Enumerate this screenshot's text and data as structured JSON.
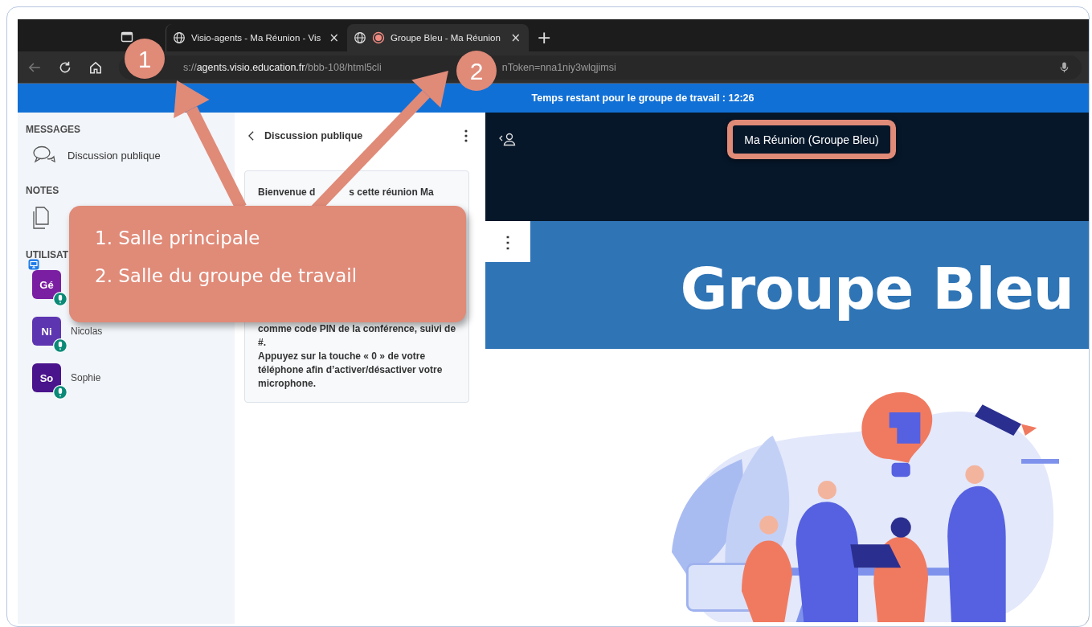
{
  "browser": {
    "tabs": [
      {
        "title": "Visio-agents - Ma Réunion - Vis",
        "close": "×",
        "selected": false,
        "recording": false
      },
      {
        "title": "Groupe Bleu - Ma Réunion",
        "close": "×",
        "selected": true,
        "recording": true
      }
    ],
    "new_tab": "+",
    "back_disabled": true,
    "address": [
      {
        "text": "s://",
        "kind": "dim"
      },
      {
        "text": "agents.visio.education.fr",
        "kind": "host"
      },
      {
        "text": "/bbb-108/html5cli",
        "kind": "dim"
      },
      {
        "text": "nToken=nna1niy3wlqjimsi",
        "kind": "dim"
      }
    ]
  },
  "banner": "Temps restant pour le groupe de travail : 12:26",
  "sidebar": {
    "messages_heading": "MESSAGES",
    "chat_item": "Discussion publique",
    "notes_heading": "NOTES",
    "users_heading": "UTILISAT",
    "users": [
      {
        "initials": "Gé",
        "color": "#7b1fa2",
        "presenter": true
      },
      {
        "initials": "Ni",
        "name": "Nicolas",
        "color": "#5e35b1",
        "presenter": false
      },
      {
        "initials": "So",
        "name": "Sophie",
        "color": "#4a148c",
        "presenter": false
      }
    ]
  },
  "chat": {
    "title": "Discussion publique",
    "welcome_top": [
      "Bienvenue d",
      "s cette réunion Ma"
    ],
    "welcome_bottom": "comme code PIN de la conférence, suivi de #.\nAppuyez sur la touche « 0 » de votre téléphone afin d’activer/désactiver votre microphone."
  },
  "meeting": {
    "title": "Ma Réunion (Groupe Bleu)",
    "slide_title": "Groupe Bleu",
    "menu": "⋮"
  },
  "annotations": {
    "markers": [
      "1",
      "2"
    ],
    "callout": [
      "1. Salle principale",
      "2. Salle du groupe de travail"
    ]
  }
}
